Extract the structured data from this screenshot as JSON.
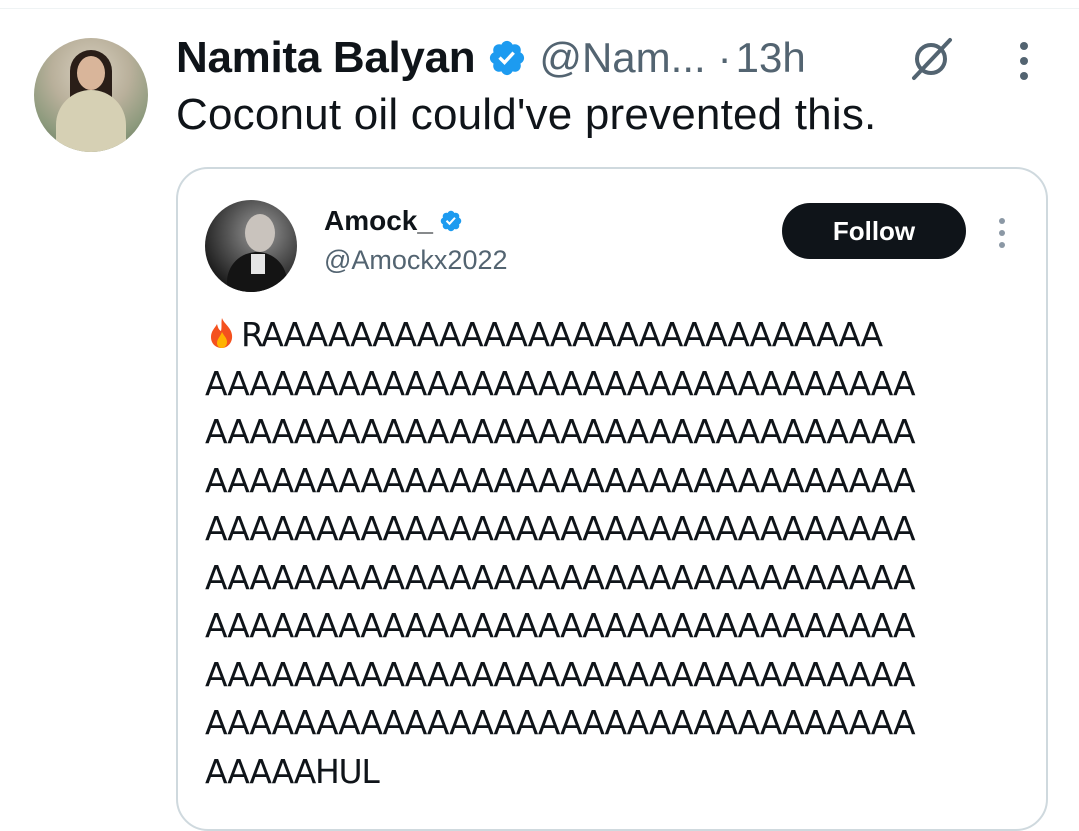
{
  "tweet": {
    "author_name": "Namita Balyan",
    "handle": "@Nam...",
    "separator": "·",
    "time": "13h",
    "text": "Coconut oil could've prevented this."
  },
  "quoted_tweet": {
    "author_name": "Amock_",
    "handle": "@Amockx2022",
    "follow_label": "Follow",
    "text": "RAAAAAAAAAAAAAAAAAAAAAAAAAAAA\nAAAAAAAAAAAAAAAAAAAAAAAAAAAAAAAA\nAAAAAAAAAAAAAAAAAAAAAAAAAAAAAAAA\nAAAAAAAAAAAAAAAAAAAAAAAAAAAAAAAA\nAAAAAAAAAAAAAAAAAAAAAAAAAAAAAAAA\nAAAAAAAAAAAAAAAAAAAAAAAAAAAAAAAA\nAAAAAAAAAAAAAAAAAAAAAAAAAAAAAAAA\nAAAAAAAAAAAAAAAAAAAAAAAAAAAAAAAA\nAAAAAAAAAAAAAAAAAAAAAAAAAAAAAAAA\nAAAAAHUL"
  },
  "icons": {
    "verified": "verified-badge-icon",
    "grok": "grok-icon",
    "more": "more-options-icon",
    "fire": "fire-emoji-icon"
  },
  "colors": {
    "verified_blue": "#1d9bf0",
    "text_primary": "#0f1419",
    "text_secondary": "#536471",
    "follow_bg": "#0f1419",
    "card_border": "#cfd9de"
  }
}
